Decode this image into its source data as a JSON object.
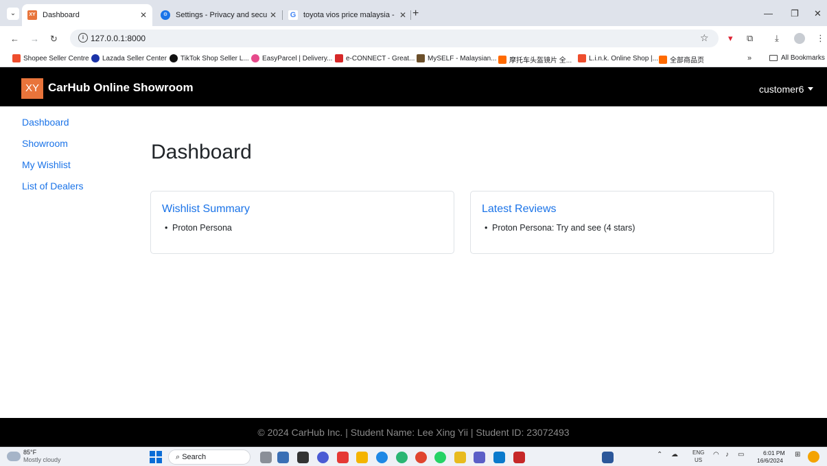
{
  "browser": {
    "tabs": [
      {
        "title": "Dashboard",
        "favicon": "xy-favicon",
        "active": true
      },
      {
        "title": "Settings - Privacy and security",
        "favicon": "gear-icon",
        "active": false
      },
      {
        "title": "toyota vios price malaysia - Goo",
        "favicon": "google-icon",
        "active": false
      }
    ],
    "url": "127.0.0.1:8000",
    "bookmarks": [
      {
        "label": "Shopee Seller Centre",
        "color": "#ee4d2d"
      },
      {
        "label": "Lazada Seller Center",
        "color": "#1b33a8"
      },
      {
        "label": "TikTok Shop Seller L...",
        "color": "#111111"
      },
      {
        "label": "EasyParcel | Delivery...",
        "color": "#e64a8b"
      },
      {
        "label": "e-CONNECT - Great...",
        "color": "#d62828"
      },
      {
        "label": "MySELF - Malaysian...",
        "color": "#6b4f2a"
      },
      {
        "label": "摩托车头盔镜片 全...",
        "color": "#ff6a00"
      },
      {
        "label": "L.i.n.k. Online Shop |...",
        "color": "#ee4d2d"
      },
      {
        "label": "全部商品页",
        "color": "#ff6a00"
      }
    ],
    "bookmarks_more": "»",
    "all_bookmarks": "All Bookmarks"
  },
  "navbar": {
    "logo": "XY",
    "brand": "CarHub Online Showroom",
    "user": "customer6"
  },
  "sidebar": {
    "items": [
      {
        "label": "Dashboard"
      },
      {
        "label": "Showroom"
      },
      {
        "label": "My Wishlist"
      },
      {
        "label": "List of Dealers"
      }
    ]
  },
  "main": {
    "title": "Dashboard",
    "wishlist": {
      "title": "Wishlist Summary",
      "items": [
        "Proton Persona"
      ]
    },
    "reviews": {
      "title": "Latest Reviews",
      "items": [
        "Proton Persona: Try and see (4 stars)"
      ]
    }
  },
  "footer": {
    "text": "© 2024 CarHub Inc. | Student Name: Lee Xing Yii | Student ID: 23072493"
  },
  "taskbar": {
    "temp": "85°F",
    "weather": "Mostly cloudy",
    "search_label": "Search",
    "lang_top": "ENG",
    "lang_bottom": "US",
    "time": "6:01 PM",
    "date": "16/6/2024"
  }
}
